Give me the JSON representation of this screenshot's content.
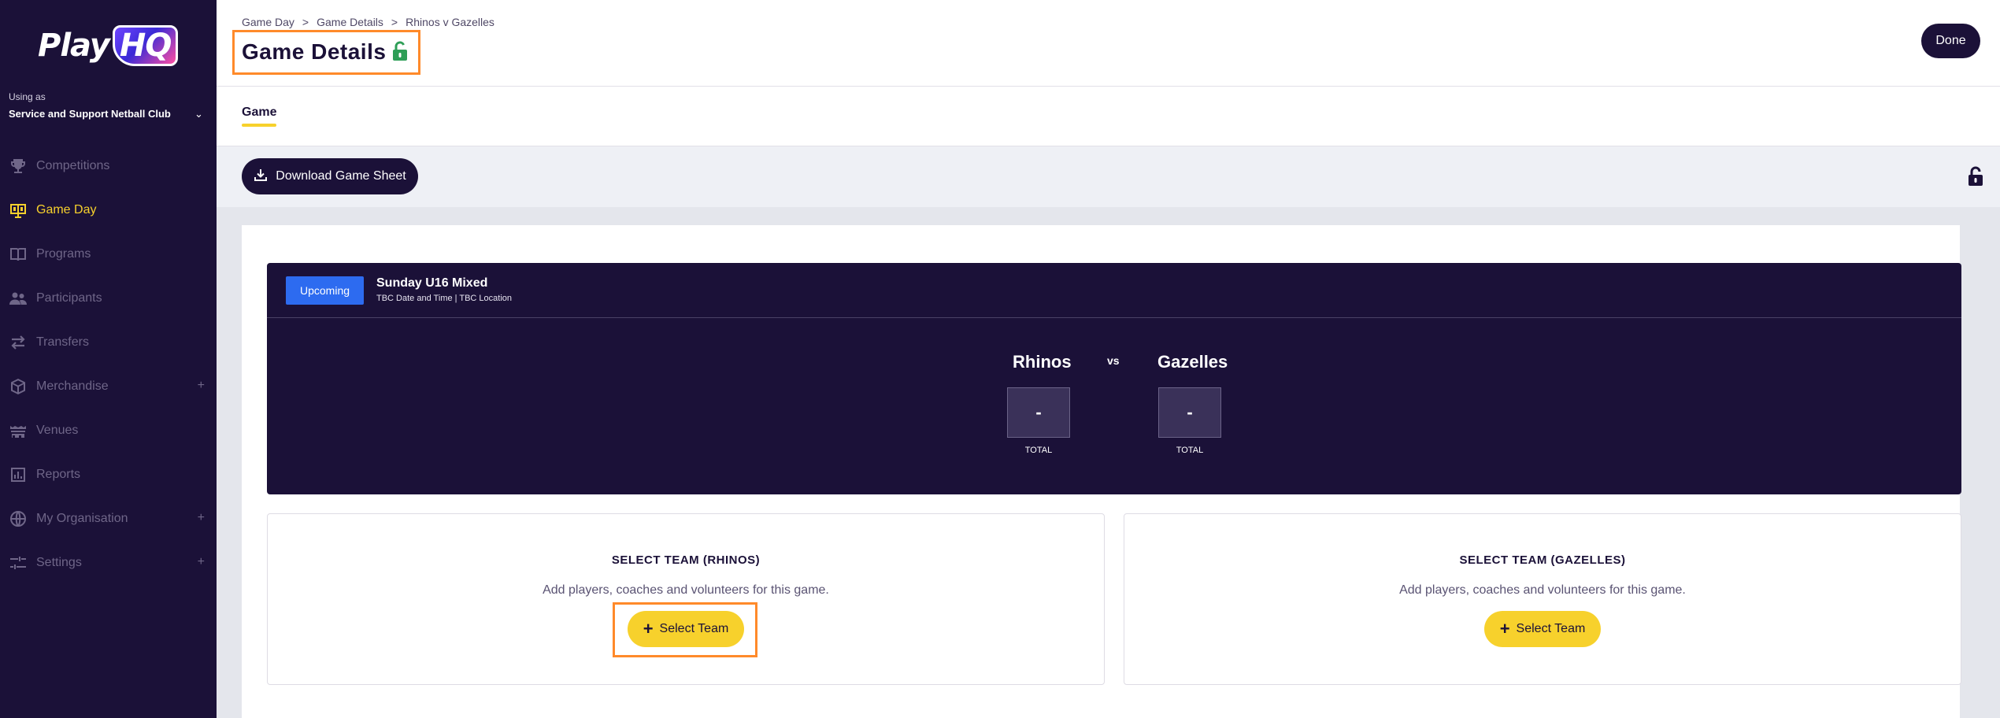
{
  "sidebar": {
    "logo": "PlayHQ",
    "logo_play": "Play",
    "logo_hq": "HQ",
    "using_as_label": "Using as",
    "org_name": "Service and Support Netball Club",
    "items": [
      {
        "label": "Competitions",
        "icon": "trophy-icon",
        "active": false,
        "expandable": false
      },
      {
        "label": "Game Day",
        "icon": "scoreboard-icon",
        "active": true,
        "expandable": false
      },
      {
        "label": "Programs",
        "icon": "book-icon",
        "active": false,
        "expandable": false
      },
      {
        "label": "Participants",
        "icon": "people-icon",
        "active": false,
        "expandable": false
      },
      {
        "label": "Transfers",
        "icon": "transfer-arrows-icon",
        "active": false,
        "expandable": false
      },
      {
        "label": "Merchandise",
        "icon": "box-icon",
        "active": false,
        "expandable": true
      },
      {
        "label": "Venues",
        "icon": "stadium-icon",
        "active": false,
        "expandable": false
      },
      {
        "label": "Reports",
        "icon": "report-icon",
        "active": false,
        "expandable": false
      },
      {
        "label": "My Organisation",
        "icon": "globe-icon",
        "active": false,
        "expandable": true
      },
      {
        "label": "Settings",
        "icon": "sliders-icon",
        "active": false,
        "expandable": true
      }
    ],
    "expand_symbol": "+"
  },
  "header": {
    "breadcrumb": [
      "Game Day",
      "Game Details",
      "Rhinos v Gazelles"
    ],
    "breadcrumb_sep": ">",
    "title": "Game Details",
    "done_label": "Done",
    "tabs": [
      {
        "label": "Game",
        "active": true
      }
    ]
  },
  "toolbar": {
    "download_label": "Download Game Sheet"
  },
  "game": {
    "status": "Upcoming",
    "name": "Sunday U16 Mixed",
    "meta": "TBC Date and Time | TBC Location",
    "home_team": "Rhinos",
    "away_team": "Gazelles",
    "vs": "vs",
    "home_score": "-",
    "away_score": "-",
    "total_label": "TOTAL"
  },
  "panels": [
    {
      "title": "SELECT TEAM (RHINOS)",
      "subtitle": "Add players, coaches and volunteers for this game.",
      "button": "Select Team"
    },
    {
      "title": "SELECT TEAM (GAZELLES)",
      "subtitle": "Add players, coaches and volunteers for this game.",
      "button": "Select Team"
    }
  ],
  "colors": {
    "brand_dark": "#1b1138",
    "accent_yellow": "#f7d12c",
    "status_blue": "#2d6bf0",
    "lock_green": "#2e9e57",
    "highlight_orange": "#ff8a2a"
  }
}
